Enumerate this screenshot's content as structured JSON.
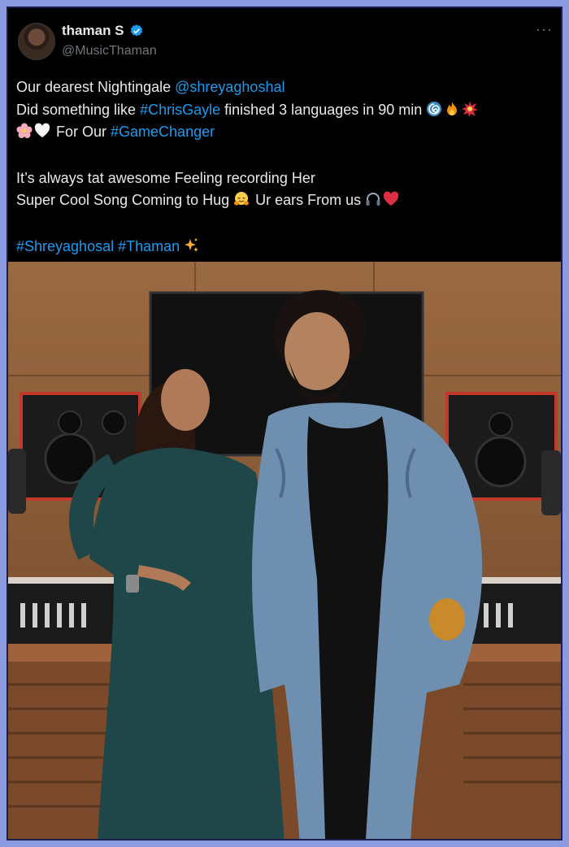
{
  "post": {
    "display_name": "thaman S",
    "handle": "@MusicThaman",
    "more_label": "···",
    "line1_text": "Our dearest Nightingale ",
    "line1_mention": "@shreyaghoshal",
    "line2_text_a": "Did something like ",
    "line2_tag": "#ChrisGayle",
    "line2_text_b": " finished 3 languages in 90 min ",
    "line3_text": " For Our ",
    "line3_tag": "#GameChanger",
    "line4_text": "It’s always tat awesome Feeling recording Her",
    "line5_text_a": "Super Cool Song Coming to Hug ",
    "line5_text_b": " Ur ears From us ",
    "line6_tag_a": "#Shreyaghosal",
    "line6_space": " ",
    "line6_tag_b": "#Thaman"
  },
  "emojis": [
    "cyclone-icon",
    "fire-icon",
    "collision-icon",
    "cherry-blossom-icon",
    "white-heart-icon",
    "hugging-face-icon",
    "headphone-icon",
    "red-heart-icon",
    "sparkles-icon"
  ],
  "colors": {
    "link": "#1d9bf0",
    "text": "#e7e9ea",
    "muted": "#71767b",
    "verified": "#1d9bf0",
    "page_border": "#8c9ae0"
  }
}
